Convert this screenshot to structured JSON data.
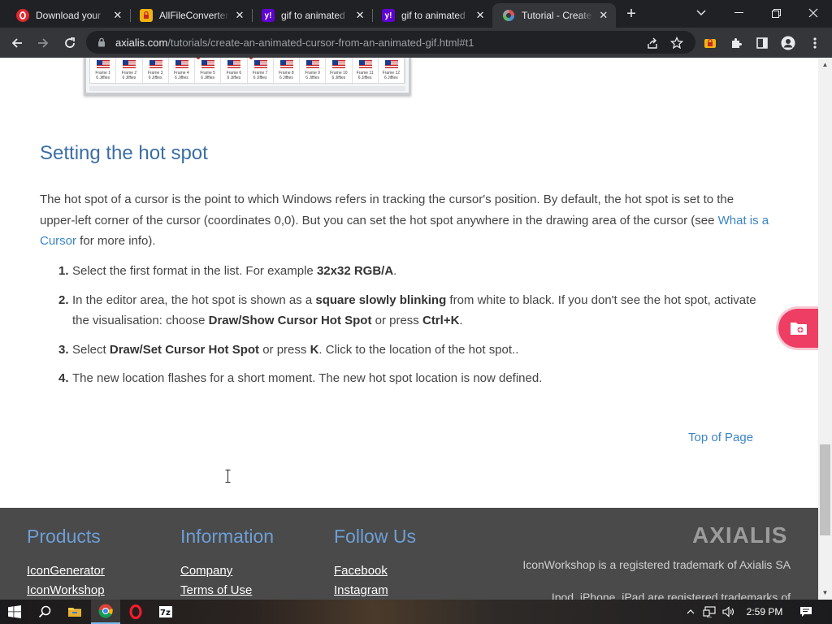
{
  "browser": {
    "tabs": [
      {
        "title": "Download your",
        "favicon": "opera-red-icon",
        "color": "#e0282d"
      },
      {
        "title": "AllFileConverter",
        "favicon": "lock-folder-icon",
        "color": "#f2b311"
      },
      {
        "title": "gif to animated",
        "favicon": "yahoo-icon",
        "color": "#6001d2"
      },
      {
        "title": "gif to animated",
        "favicon": "yahoo-icon",
        "color": "#6001d2"
      },
      {
        "title": "Tutorial - Create",
        "favicon": "axialis-icon",
        "color": "#e94f4f",
        "active": true
      }
    ],
    "url": {
      "host": "axialis.com",
      "path": "/tutorials/create-an-animated-cursor-from-an-animated-gif.html#t1"
    }
  },
  "content": {
    "frames": [
      "Frame 1",
      "Frame 2",
      "Frame 3",
      "Frame 4",
      "Frame 5",
      "Frame 6",
      "Frame 7",
      "Frame 8",
      "Frame 9",
      "Frame 10",
      "Frame 11",
      "Frame 12"
    ],
    "frame_duration": "6 Jiffies",
    "heading": "Setting the hot spot",
    "intro_before": "The hot spot of a cursor is the point to which Windows refers in tracking the cursor's position. By default, the hot spot is set to the upper-left corner of the cursor (coordinates 0,0). But you can set the hot spot anywhere in the drawing area of the cursor (see ",
    "intro_link": "What is a Cursor",
    "intro_after": " for more info).",
    "steps": [
      {
        "num": "1.",
        "t1": "Select the first format in the list. For example ",
        "b1": "32x32 RGB/A",
        "t2": "."
      },
      {
        "num": "2.",
        "t1": "In the editor area, the hot spot is shown as a ",
        "b1": "square slowly blinking",
        "t2": " from white to black. If you don't see the hot spot, activate the visualisation: choose ",
        "b2": "Draw/Show Cursor Hot Spot",
        "t3": " or press ",
        "b3": "Ctrl+K",
        "t4": "."
      },
      {
        "num": "3.",
        "t1": "Select ",
        "b1": "Draw/Set Cursor Hot Spot",
        "t2": " or press ",
        "b2": "K",
        "t3": ". Click to the location of the hot spot.."
      },
      {
        "num": "4.",
        "t1": "The new location flashes for a short moment. The new hot spot location is now defined."
      }
    ],
    "top_of_page": "Top of Page"
  },
  "footer": {
    "products": {
      "heading": "Products",
      "links": [
        "IconGenerator",
        "IconWorkshop"
      ]
    },
    "information": {
      "heading": "Information",
      "links": [
        "Company",
        "Terms of Use"
      ]
    },
    "follow": {
      "heading": "Follow Us",
      "links": [
        "Facebook",
        "Instagram"
      ]
    },
    "logo": "AXIALIS",
    "legal": [
      "IconWorkshop is a registered trademark of Axialis SA",
      "Ipod, iPhone, iPad are registered trademarks of"
    ]
  },
  "taskbar": {
    "time": "2:59 PM"
  }
}
